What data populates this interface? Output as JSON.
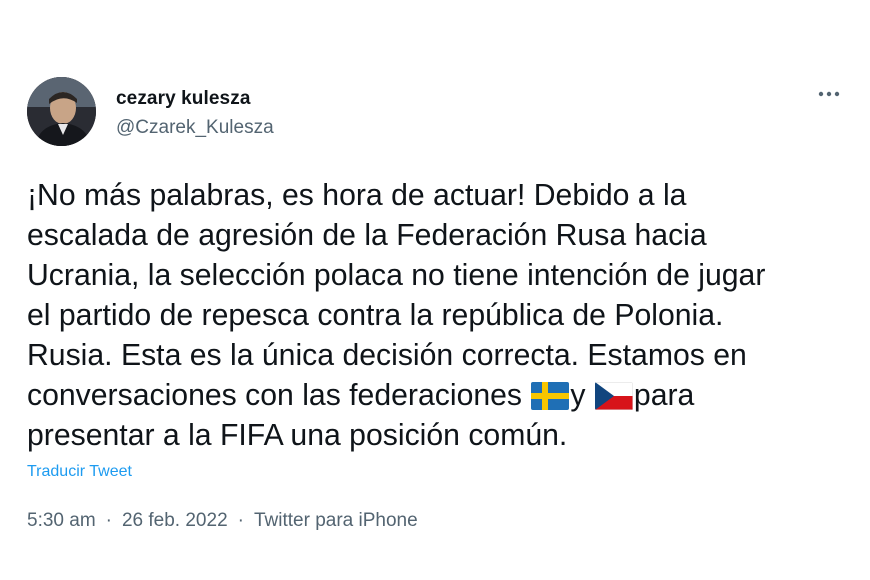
{
  "author": {
    "display_name": "cezary kulesza",
    "handle": "@Czarek_Kulesza",
    "avatar_icon": "profile-photo"
  },
  "more_icon": "more-horizontal-icon",
  "tweet": {
    "segments": [
      {
        "type": "text",
        "value": "¡No más palabras, es hora de actuar! Debido a la\nescalada de agresión de la Federación Rusa hacia\nUcrania, la selección polaca no tiene intención de jugar\nel partido de repesca contra la república de Polonia.\nRusia. Esta es la única decisión correcta. Estamos en\nconversaciones con las federaciones "
      },
      {
        "type": "flag",
        "value": "sweden-flag-icon"
      },
      {
        "type": "text",
        "value": "y "
      },
      {
        "type": "flag",
        "value": "czech-flag-icon"
      },
      {
        "type": "text",
        "value": "para\npresentar a la FIFA una posición común."
      }
    ]
  },
  "translate_label": "Traducir Tweet",
  "meta": {
    "time": "5:30 am",
    "date": "26 feb. 2022",
    "separator": "·",
    "source": "Twitter para iPhone"
  },
  "colors": {
    "text": "#0f1419",
    "secondary": "#536471",
    "link": "#1d9bf0",
    "background": "#ffffff"
  }
}
